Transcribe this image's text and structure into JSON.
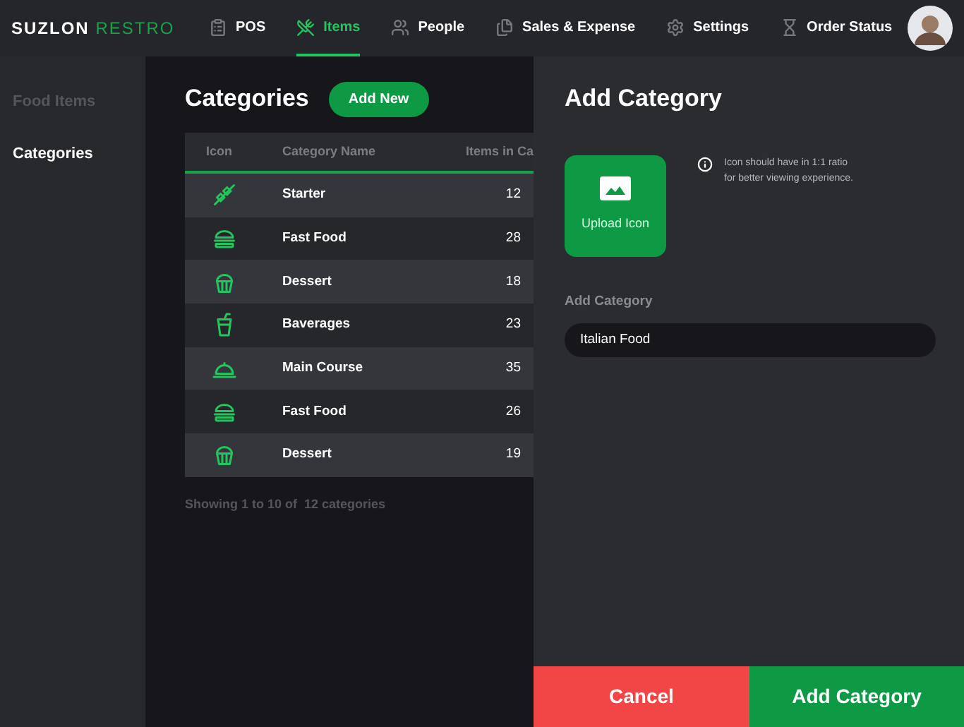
{
  "brand": {
    "first": "SUZLON",
    "second": "RESTRO"
  },
  "nav": [
    {
      "label": "POS",
      "kind": "clipboard",
      "selected": false
    },
    {
      "label": "Items",
      "kind": "utensils",
      "selected": true
    },
    {
      "label": "People",
      "kind": "users",
      "selected": false
    },
    {
      "label": "Sales & Expense",
      "kind": "files",
      "selected": false
    },
    {
      "label": "Settings",
      "kind": "gear",
      "selected": false
    },
    {
      "label": "Order Status",
      "kind": "hourglass",
      "selected": false
    }
  ],
  "sidebar": {
    "items": [
      {
        "label": "Food Items",
        "selected": false
      },
      {
        "label": "Categories",
        "selected": true
      }
    ]
  },
  "page": {
    "title": "Categories",
    "add_button": "Add New"
  },
  "table": {
    "columns": [
      "Icon",
      "Category Name",
      "Items in Ca"
    ],
    "rows": [
      {
        "kind": "skewer",
        "name": "Starter",
        "count": "12"
      },
      {
        "kind": "burger",
        "name": "Fast Food",
        "count": "28"
      },
      {
        "kind": "cupcake",
        "name": "Dessert",
        "count": "18"
      },
      {
        "kind": "drink",
        "name": "Baverages",
        "count": "23"
      },
      {
        "kind": "cloche",
        "name": "Main Course",
        "count": "35"
      },
      {
        "kind": "burger",
        "name": "Fast Food",
        "count": "26"
      },
      {
        "kind": "cupcake",
        "name": "Dessert",
        "count": "19"
      }
    ]
  },
  "footer": "Showing 1 to 10 of  12 categories",
  "panel": {
    "title": "Add Category",
    "upload_label": "Upload Icon",
    "hint": "Icon should have in 1:1 ratio for better viewing experience.",
    "field_label": "Add Category",
    "field_value": "Italian Food",
    "cancel": "Cancel",
    "submit": "Add Category"
  }
}
